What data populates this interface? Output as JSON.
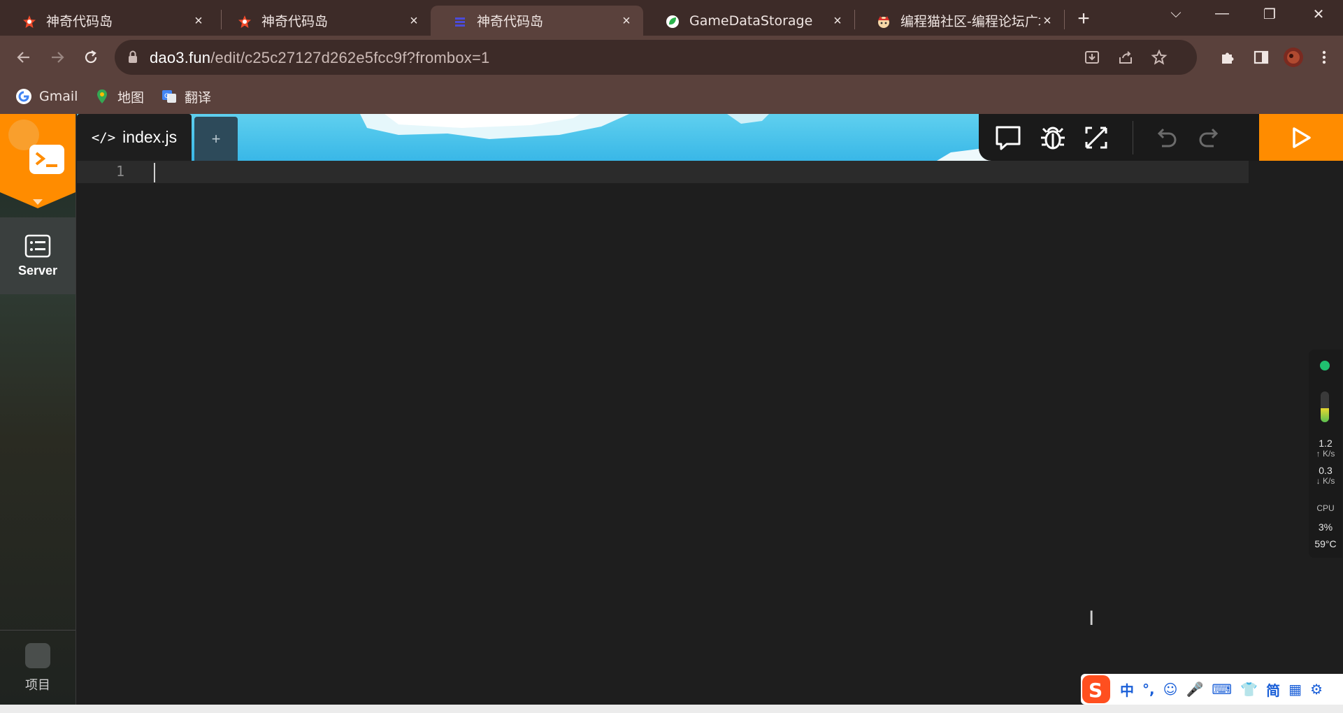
{
  "browser": {
    "tabs": [
      {
        "title": "神奇代码岛",
        "close": "×",
        "icon": "dao3-star-icon"
      },
      {
        "title": "神奇代码岛",
        "close": "×",
        "icon": "dao3-star-icon"
      },
      {
        "title": "神奇代码岛",
        "close": "×",
        "icon": "dao3-pixel-icon",
        "active": true
      },
      {
        "title": "GameDataStorage",
        "close": "×",
        "icon": "green-leaf-icon"
      },
      {
        "title": "编程猫社区-编程论坛广场",
        "close": "×",
        "icon": "codemao-cat-icon"
      }
    ],
    "new_tab": "+",
    "url_host": "dao3.fun",
    "url_path": "/edit/c25c27127d262e5fcc9f?frombox=1",
    "bookmarks": [
      {
        "label": "Gmail",
        "icon": "google-icon"
      },
      {
        "label": "地图",
        "icon": "maps-icon"
      },
      {
        "label": "翻译",
        "icon": "translate-icon"
      }
    ],
    "colors": {
      "frame": "#3d2b28",
      "toolbar": "#5a413c"
    }
  },
  "editor": {
    "sidebar": {
      "server_label": "Server",
      "project_label": "项目"
    },
    "file_tab": {
      "icon": "</>",
      "label": "index.js"
    },
    "add_tab": "+",
    "line_numbers": [
      "1"
    ],
    "accent": "#ff8c00"
  },
  "monitor": {
    "upload_value": "1.2",
    "upload_unit": "↑ K/s",
    "download_value": "0.3",
    "download_unit": "↓ K/s",
    "cpu_label": "CPU",
    "cpu_value": "3%",
    "temp_value": "59°C",
    "memory_fraction": 0.45
  },
  "ime": {
    "items": [
      "中",
      "°,",
      "☺",
      "🎤",
      "⌨",
      "👕",
      "简",
      "▦",
      "⚙"
    ]
  }
}
